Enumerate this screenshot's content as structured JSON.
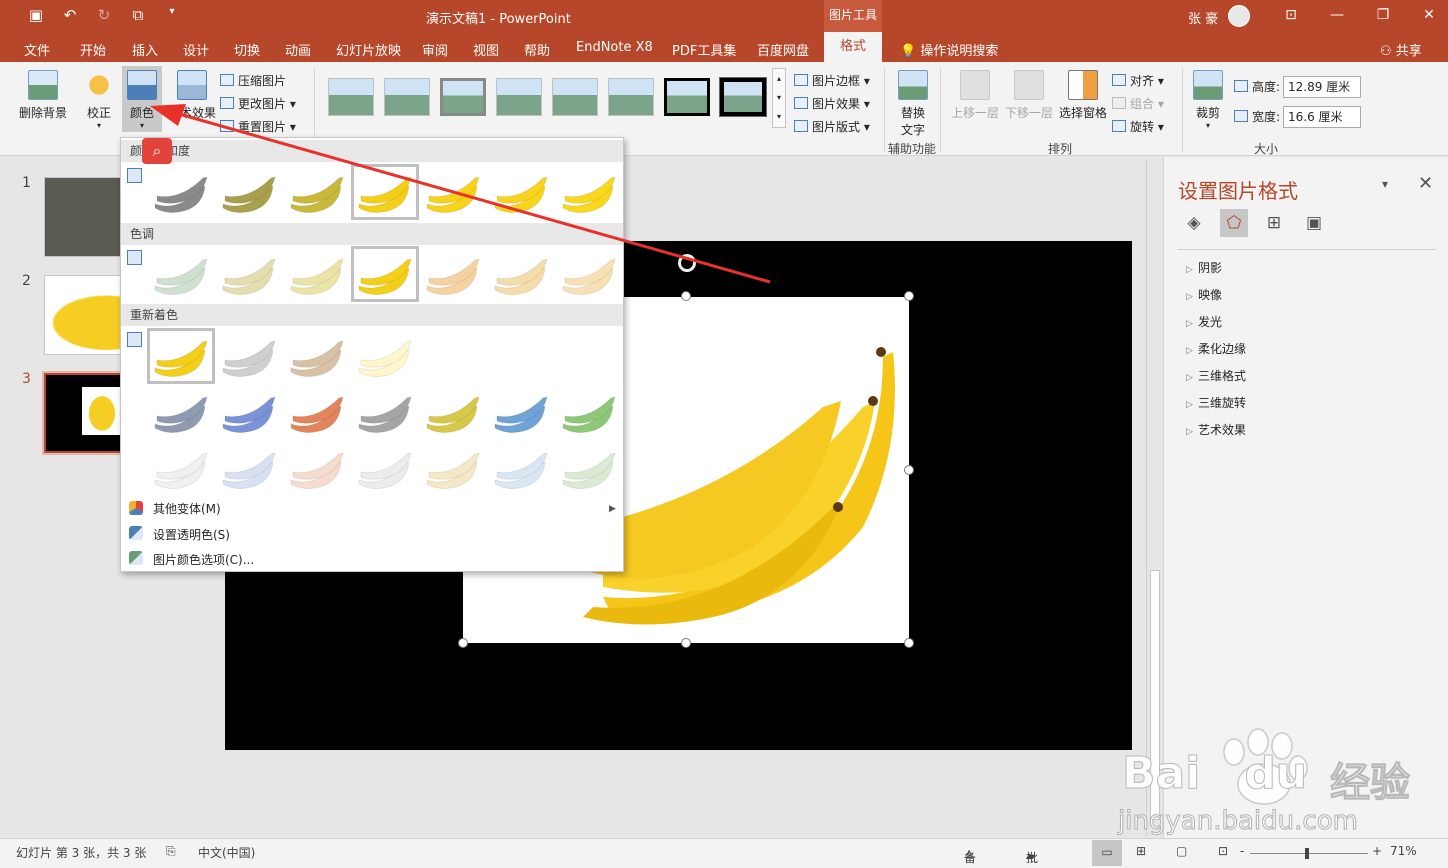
{
  "titlebar": {
    "doc_title": "演示文稿1  -  PowerPoint",
    "context_tab_group": "图片工具",
    "user_name": "张 豪",
    "colors": {
      "brand": "#b7472a",
      "context": "#c75a3c"
    }
  },
  "tabs": [
    "文件",
    "开始",
    "插入",
    "设计",
    "切换",
    "动画",
    "幻灯片放映",
    "审阅",
    "视图",
    "帮助",
    "EndNote X8",
    "PDF工具集",
    "百度网盘"
  ],
  "active_tab": "格式",
  "tell_me": "操作说明搜索",
  "share": "共享",
  "ribbon": {
    "remove_bg": "删除背景",
    "corrections": "校正",
    "color": "颜色",
    "artistic": "艺术效果",
    "compress": "压缩图片",
    "change_pic": "更改图片",
    "reset_pic": "重置图片",
    "pic_border": "图片边框",
    "pic_effects": "图片效果",
    "pic_layout": "图片版式",
    "alt_text_1": "替换",
    "alt_text_2": "文字",
    "accessibility": "辅助功能",
    "bring_forward": "上移一层",
    "send_backward": "下移一层",
    "selection_pane": "选择窗格",
    "align": "对齐",
    "group": "组合",
    "rotate": "旋转",
    "arrange": "排列",
    "crop": "裁剪",
    "height_label": "高度:",
    "height_value": "12.89 厘米",
    "width_label": "宽度:",
    "width_value": "16.6 厘米",
    "size": "大小"
  },
  "slides": [
    {
      "number": "1"
    },
    {
      "number": "2"
    },
    {
      "number": "3"
    }
  ],
  "color_menu": {
    "section_saturation": "颜色饱和度",
    "section_tone": "色调",
    "section_recolor": "重新着色",
    "more_variations": "其他变体(M)",
    "set_transparent": "设置透明色(S)",
    "color_options": "图片颜色选项(C)...",
    "saturation_swatches": [
      "#8a8a8a",
      "#a9a04e",
      "#c9b83a",
      "#f3cf18",
      "#f6d21a",
      "#f8d41c",
      "#fad71f"
    ],
    "tone_swatches": [
      "#cfe0d0",
      "#e4ddb0",
      "#ece3a6",
      "#f3cf18",
      "#f6d2a0",
      "#f6dcaa",
      "#f7e1b4"
    ],
    "recolor_row1": [
      "#f3cf18",
      "#cfcfcf",
      "#d8c1a4",
      "#fff6cc",
      "#ffffff",
      "#ffffff"
    ],
    "recolor_row2": [
      "#8f9bb0",
      "#7b93d6",
      "#e2845c",
      "#a5a5a5",
      "#d6c94a",
      "#6fa2d6",
      "#8fc779"
    ],
    "recolor_row3": [
      "#f0f0f0",
      "#d8e1f3",
      "#f6dccf",
      "#ececec",
      "#f5e8c6",
      "#d9e6f3",
      "#dcead4"
    ]
  },
  "format_pane": {
    "title": "设置图片格式",
    "items": [
      "阴影",
      "映像",
      "发光",
      "柔化边缘",
      "三维格式",
      "三维旋转",
      "艺术效果"
    ]
  },
  "statusbar": {
    "slide_info": "幻灯片 第 3 张，共 3 张",
    "language": "中文(中国)",
    "notes": "备注",
    "comments": "批注",
    "zoom_minus": "-",
    "zoom_plus": "+",
    "zoom": "71%"
  },
  "watermark": {
    "brand": "Bai",
    "brand2": "du",
    "cn": "经验",
    "url": "jingyan.baidu.com"
  }
}
